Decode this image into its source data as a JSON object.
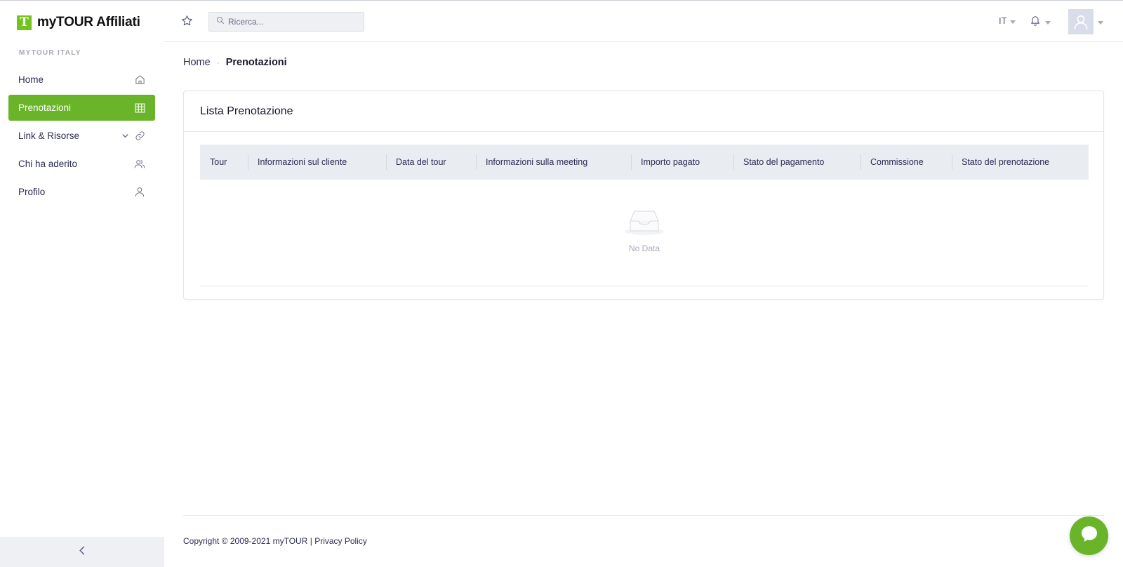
{
  "brand": {
    "logo_letter": "T",
    "name": "myTOUR Affiliati"
  },
  "sidebar": {
    "section_label": "MYTOUR ITALY",
    "items": [
      {
        "label": "Home",
        "icon": "home-icon",
        "active": false
      },
      {
        "label": "Prenotazioni",
        "icon": "table-icon",
        "active": true
      },
      {
        "label": "Link & Risorse",
        "icon": "link-icon",
        "active": false,
        "expandable": true
      },
      {
        "label": "Chi ha aderito",
        "icon": "users-icon",
        "active": false
      },
      {
        "label": "Profilo",
        "icon": "user-icon",
        "active": false
      }
    ],
    "collapse_icon": "chevron-left-icon"
  },
  "header": {
    "search_placeholder": "Ricerca...",
    "language": "IT"
  },
  "breadcrumb": {
    "home": "Home",
    "separator": "·",
    "current": "Prenotazioni"
  },
  "card": {
    "title": "Lista Prenotazione",
    "columns": [
      "Tour",
      "Informazioni sul cliente",
      "Data del tour",
      "Informazioni sulla meeting",
      "Importo pagato",
      "Stato del pagamento",
      "Commissione",
      "Stato del prenotazione"
    ],
    "empty_text": "No Data"
  },
  "footer": {
    "copyright": "Copyright © 2009-2021 myTOUR",
    "separator": "|",
    "privacy": "Privacy Policy"
  },
  "colors": {
    "accent": "#6ab42a",
    "brand_green": "#74c41f",
    "header_bg": "#e9ecf1"
  }
}
